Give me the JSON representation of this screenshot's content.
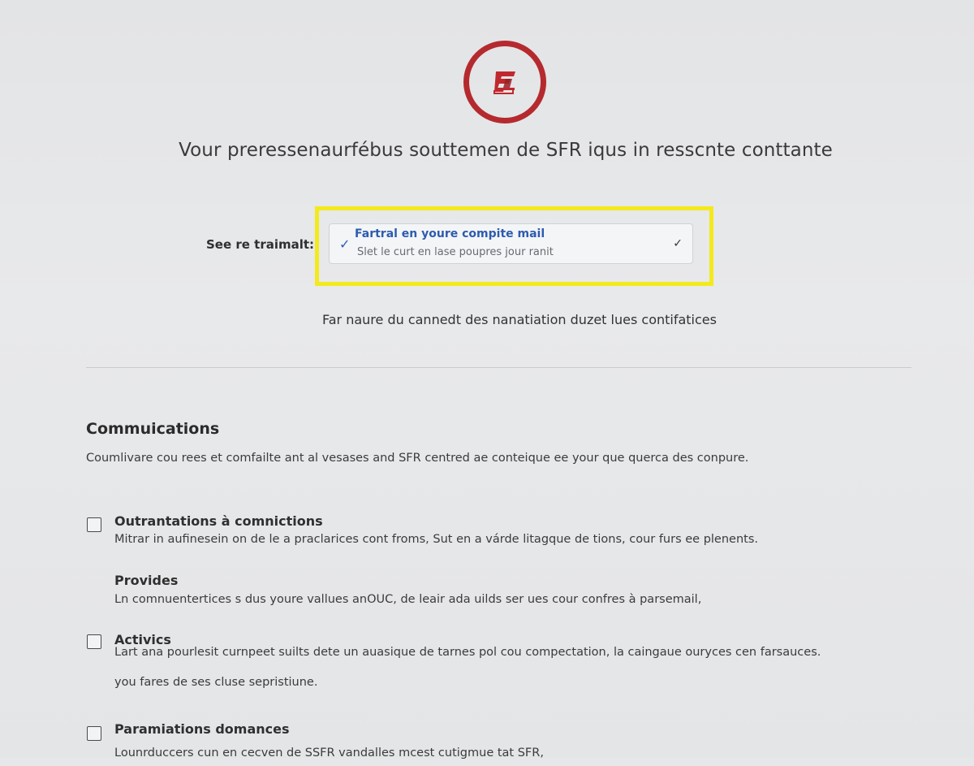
{
  "header": {
    "headline": "Vour preressenaurfébus souttemen de SFR iqus in resscnte conttante"
  },
  "select": {
    "label": "See re traimalt:",
    "title": "Fartral en youre compite mail",
    "subtitle": "Slet le curt en lase poupres jour ranit"
  },
  "helper_text": "Far naure du cannedt des nanatiation duzet lues contifatices",
  "section": {
    "title": "Commuications",
    "description": "Coumlivare cou rees et comfailte ant al vesases and SFR centred ae conteique ee your que querca des conpure."
  },
  "options": [
    {
      "title": "Outrantations à comnictions",
      "description": "Mitrar in aufinesein on de le a praclarices cont froms, Sut en a várde litagque de tions, cour furs ee plenents.",
      "checked": false
    },
    {
      "title": "Provides",
      "description": "Ln comnuentertices s dus youre vallues anOUC, de leair ada uilds ser ues cour confres à parsemail,"
    },
    {
      "title": "Activics",
      "description_line1": "Lart ana pourlesit curnpeet suilts dete un auasique de tarnes pol cou compectation, la caingaue ouryces cen farsauces.",
      "description_line2": "you fares de ses cluse sepristiune.",
      "checked": false
    },
    {
      "title": "Paramiations domances",
      "description": "Lounrduccers cun en cecven de SSFR vandalles mcest cutigmue tat SFR,",
      "checked": false
    }
  ],
  "colors": {
    "brand_red": "#b52a2e",
    "highlight_yellow": "#f3ea1c",
    "link_blue": "#2d5cae"
  }
}
